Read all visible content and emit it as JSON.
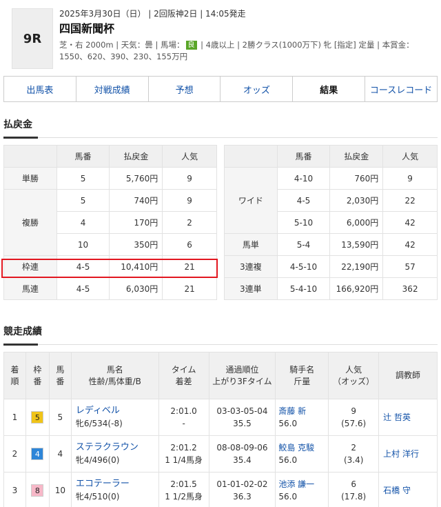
{
  "race": {
    "number": "9R",
    "date_line": "2025年3月30日（日） | 2回阪神2日 | 14:05発走",
    "name": "四国新聞杯",
    "cond_a": "芝・右 2000m | 天気：曇 | 馬場：",
    "baba": "良",
    "cond_b": " | 4歳以上 | 2勝クラス(1000万下) 牝 [指定] 定量 | 本賞金：1550、620、390、230、155万円"
  },
  "tabs": [
    {
      "label": "出馬表",
      "active": false
    },
    {
      "label": "対戦成績",
      "active": false
    },
    {
      "label": "予想",
      "active": false
    },
    {
      "label": "オッズ",
      "active": false
    },
    {
      "label": "結果",
      "active": true
    },
    {
      "label": "コースレコード",
      "active": false
    }
  ],
  "payout_title": "払戻金",
  "payout_headers": {
    "umaban": "馬番",
    "payout": "払戻金",
    "ninki": "人気"
  },
  "payout_left": {
    "tansho": {
      "label": "単勝",
      "rows": [
        {
          "umaban": "5",
          "payout": "5,760円",
          "ninki": "9"
        }
      ]
    },
    "fukusho": {
      "label": "複勝",
      "rows": [
        {
          "umaban": "5",
          "payout": "740円",
          "ninki": "9"
        },
        {
          "umaban": "4",
          "payout": "170円",
          "ninki": "2"
        },
        {
          "umaban": "10",
          "payout": "350円",
          "ninki": "6"
        }
      ]
    },
    "wakuren": {
      "label": "枠連",
      "rows": [
        {
          "umaban": "4-5",
          "payout": "10,410円",
          "ninki": "21"
        }
      ]
    },
    "umaren": {
      "label": "馬連",
      "rows": [
        {
          "umaban": "4-5",
          "payout": "6,030円",
          "ninki": "21"
        }
      ]
    }
  },
  "payout_right": {
    "wide": {
      "label": "ワイド",
      "rows": [
        {
          "umaban": "4-10",
          "payout": "760円",
          "ninki": "9"
        },
        {
          "umaban": "4-5",
          "payout": "2,030円",
          "ninki": "22"
        },
        {
          "umaban": "5-10",
          "payout": "6,000円",
          "ninki": "42"
        }
      ]
    },
    "umatan": {
      "label": "馬単",
      "rows": [
        {
          "umaban": "5-4",
          "payout": "13,590円",
          "ninki": "42"
        }
      ]
    },
    "sanrenpuku": {
      "label": "3連複",
      "rows": [
        {
          "umaban": "4-5-10",
          "payout": "22,190円",
          "ninki": "57"
        }
      ]
    },
    "sanrentan": {
      "label": "3連単",
      "rows": [
        {
          "umaban": "5-4-10",
          "payout": "166,920円",
          "ninki": "362"
        }
      ]
    }
  },
  "results_title": "競走成績",
  "results_headers": {
    "rank": "着\n順",
    "waku": "枠\n番",
    "umaban": "馬\n番",
    "horse": "馬名\n性齢/馬体重/B",
    "time": "タイム\n着差",
    "passing": "通過順位\n上がり3Fタイム",
    "jockey": "騎手名\n斤量",
    "ninki": "人気\n（オッズ）",
    "trainer": "調教師"
  },
  "results": [
    {
      "rank": "1",
      "waku": "5",
      "waku_bg": "#f0c419",
      "waku_fg": "#222",
      "umaban": "5",
      "horse": "レディベル",
      "sex_weight": "牝6/534(-8)",
      "time": "2:01.0",
      "margin": "-",
      "passing": "03-03-05-04",
      "last3f": "35.5",
      "jockey": "斎藤 新",
      "kinryo": "56.0",
      "ninki": "9",
      "odds": "(57.6)",
      "trainer": "辻 哲英"
    },
    {
      "rank": "2",
      "waku": "4",
      "waku_bg": "#2e86d8",
      "waku_fg": "#fff",
      "umaban": "4",
      "horse": "ステラクラウン",
      "sex_weight": "牝4/496(0)",
      "time": "2:01.2",
      "margin": "1 1/4馬身",
      "passing": "08-08-09-06",
      "last3f": "35.4",
      "jockey": "鮫島 克駿",
      "kinryo": "56.0",
      "ninki": "2",
      "odds": "(3.4)",
      "trainer": "上村 洋行"
    },
    {
      "rank": "3",
      "waku": "8",
      "waku_bg": "#f7b8c8",
      "waku_fg": "#222",
      "umaban": "10",
      "horse": "エコテーラー",
      "sex_weight": "牝4/510(0)",
      "time": "2:01.5",
      "margin": "1 1/2馬身",
      "passing": "01-01-02-02",
      "last3f": "36.3",
      "jockey": "池添 謙一",
      "kinryo": "56.0",
      "ninki": "6",
      "odds": "(17.8)",
      "trainer": "石橋 守"
    }
  ],
  "colors": {
    "link": "#1252a8",
    "highlight": "#e2161f",
    "baba": "#5aa628"
  }
}
